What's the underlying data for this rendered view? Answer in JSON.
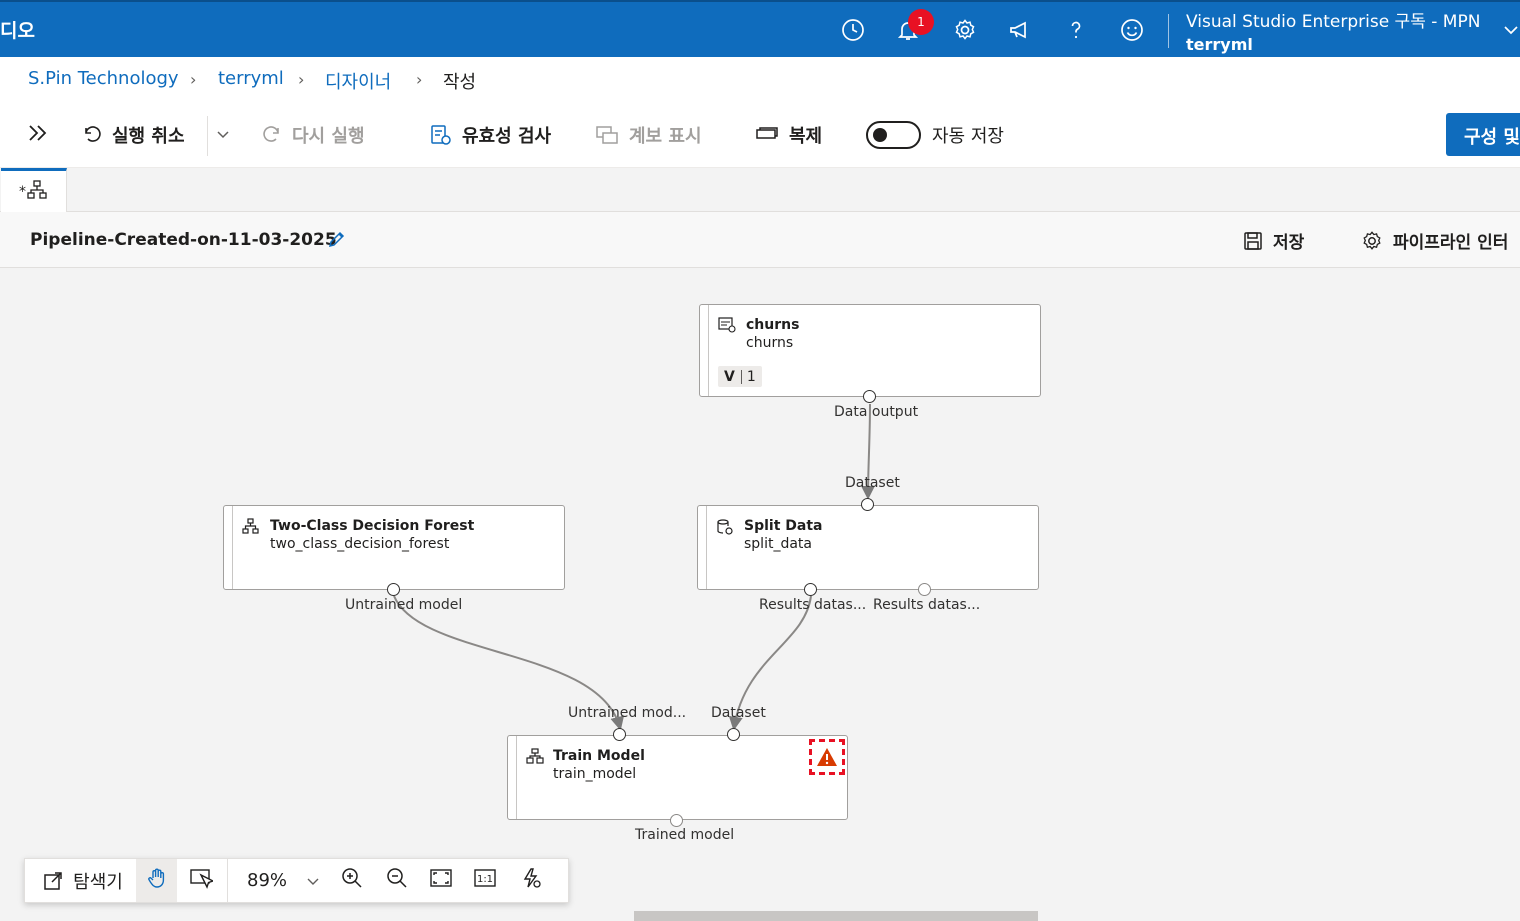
{
  "app": {
    "title": "디오",
    "notification_count": "1",
    "subscription": "Visual Studio Enterprise 구독 - MPN",
    "workspace": "terryml",
    "icons": [
      "history-icon",
      "bell-icon",
      "gear-icon",
      "megaphone-icon",
      "help-icon",
      "smiley-icon",
      "chevron-down-icon"
    ]
  },
  "breadcrumb": {
    "items": [
      "S.Pin Technology",
      "terryml",
      "디자이너",
      "작성"
    ]
  },
  "toolbar": {
    "undo": "실행 취소",
    "redo": "다시 실행",
    "validate": "유효성 검사",
    "show_lineage": "계보 표시",
    "clone": "복제",
    "autosave": "자동 저장",
    "autosave_on": true,
    "configure": "구성 및"
  },
  "tab": {
    "label": "*"
  },
  "pipeline": {
    "name": "Pipeline-Created-on-11-03-2025",
    "save": "저장",
    "interface": "파이프라인 인터"
  },
  "nodes": {
    "churns": {
      "title": "churns",
      "subtitle": "churns",
      "version_label": "V",
      "version": "1",
      "output": "Data output"
    },
    "split": {
      "title": "Split Data",
      "subtitle": "split_data",
      "input": "Dataset",
      "output1": "Results datas...",
      "output2": "Results datas..."
    },
    "forest": {
      "title": "Two-Class Decision Forest",
      "subtitle": "two_class_decision_forest",
      "output": "Untrained model"
    },
    "train": {
      "title": "Train Model",
      "subtitle": "train_model",
      "input1": "Untrained mod...",
      "input2": "Dataset",
      "output": "Trained model",
      "has_warning": true
    }
  },
  "bottom_toolbar": {
    "explorer": "탐색기",
    "zoom": "89%"
  },
  "colors": {
    "primary": "#0f6cbd",
    "badge": "#e81123",
    "warning": "#d83b01"
  }
}
